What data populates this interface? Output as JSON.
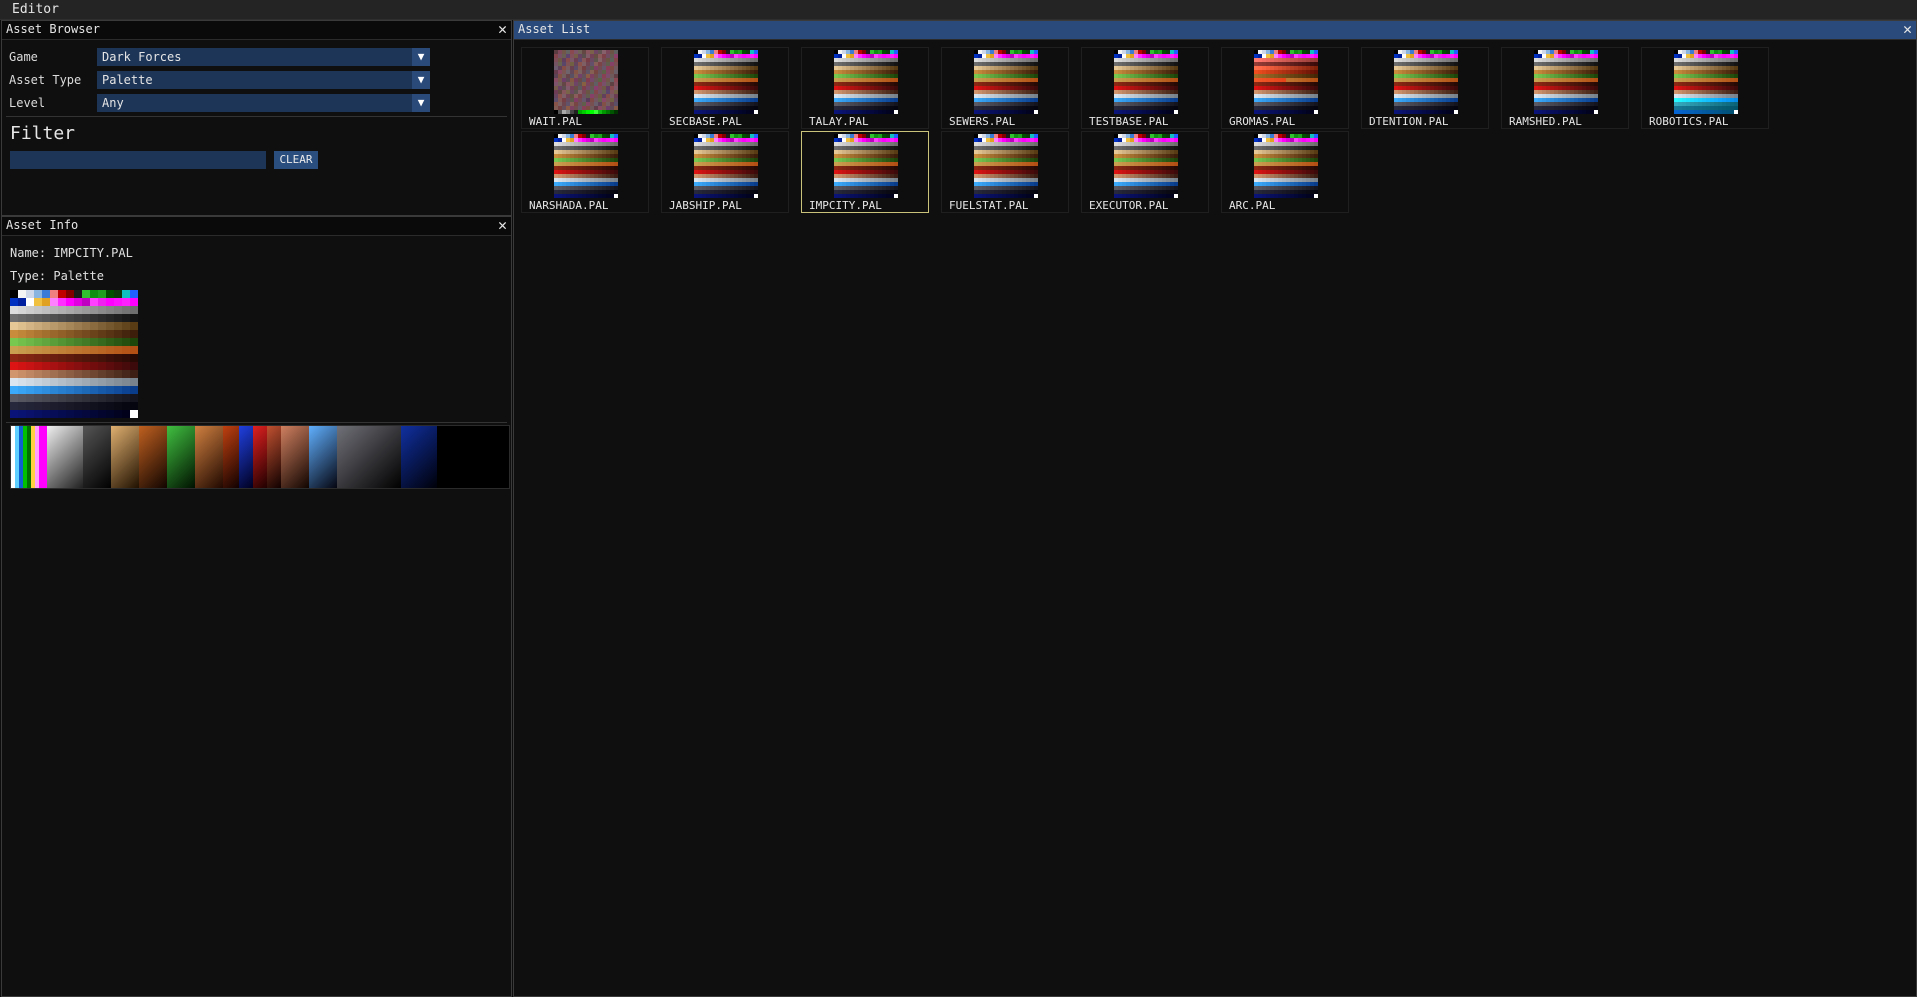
{
  "menubar": {
    "editor_label": "Editor"
  },
  "asset_browser": {
    "title": "Asset Browser",
    "close_glyph": "✕",
    "game_label": "Game",
    "game_value": "Dark Forces",
    "asset_type_label": "Asset Type",
    "asset_type_value": "Palette",
    "level_label": "Level",
    "level_value": "Any",
    "dropdown_arrow": "▼",
    "filter_heading": "Filter",
    "filter_value": "",
    "clear_label": "CLEAR"
  },
  "asset_info": {
    "title": "Asset Info",
    "close_glyph": "✕",
    "name_line": "Name: IMPCITY.PAL",
    "type_line": "Type: Palette"
  },
  "asset_list": {
    "title": "Asset List",
    "close_glyph": "✕",
    "selected": "IMPCITY.PAL",
    "items": [
      {
        "label": "WAIT.PAL",
        "thumb_style": "noise"
      },
      {
        "label": "SECBASE.PAL",
        "thumb_style": "standard"
      },
      {
        "label": "TALAY.PAL",
        "thumb_style": "standard"
      },
      {
        "label": "SEWERS.PAL",
        "thumb_style": "standard"
      },
      {
        "label": "TESTBASE.PAL",
        "thumb_style": "standard"
      },
      {
        "label": "GROMAS.PAL",
        "thumb_style": "red"
      },
      {
        "label": "DTENTION.PAL",
        "thumb_style": "standard"
      },
      {
        "label": "RAMSHED.PAL",
        "thumb_style": "standard"
      },
      {
        "label": "ROBOTICS.PAL",
        "thumb_style": "cyan"
      },
      {
        "label": "NARSHADA.PAL",
        "thumb_style": "standard"
      },
      {
        "label": "JABSHIP.PAL",
        "thumb_style": "standard"
      },
      {
        "label": "IMPCITY.PAL",
        "thumb_style": "standard"
      },
      {
        "label": "FUELSTAT.PAL",
        "thumb_style": "standard"
      },
      {
        "label": "EXECUTOR.PAL",
        "thumb_style": "standard"
      },
      {
        "label": "ARC.PAL",
        "thumb_style": "standard"
      }
    ]
  },
  "colors": {
    "active_title": "#294a7a",
    "combo_bg": "#1d3557",
    "selection_border": "#c9c27a"
  }
}
